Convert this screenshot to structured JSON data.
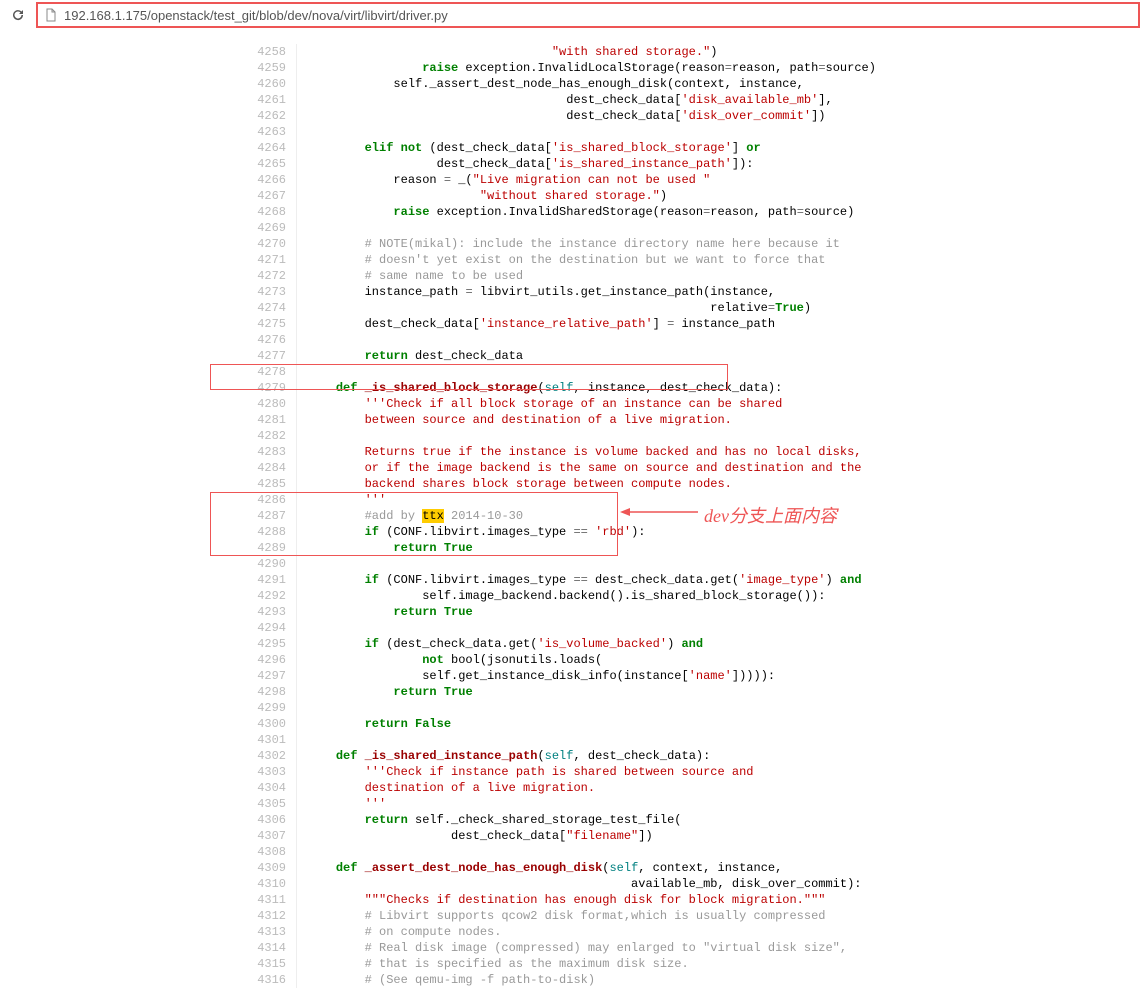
{
  "browser": {
    "url": "192.168.1.175/openstack/test_git/blob/dev/nova/virt/libvirt/driver.py"
  },
  "annotation": {
    "label": "dev分支上面内容"
  },
  "code": {
    "first_line": 4258,
    "lines": [
      {
        "i": 0,
        "w": [
          [
            "                                  ",
            ""
          ],
          [
            "\"with shared storage.\"",
            "stc"
          ],
          [
            ")",
            ""
          ]
        ]
      },
      {
        "i": 0,
        "w": [
          [
            "                ",
            ""
          ],
          [
            "raise",
            "kw"
          ],
          [
            " exception.InvalidLocalStorage(reason",
            ""
          ],
          [
            "=",
            "op"
          ],
          [
            "reason, path",
            ""
          ],
          [
            "=",
            "op"
          ],
          [
            "source)",
            ""
          ]
        ]
      },
      {
        "i": 0,
        "w": [
          [
            "            self._assert_dest_node_has_enough_disk(context, instance,",
            ""
          ]
        ]
      },
      {
        "i": 0,
        "w": [
          [
            "                                    dest_check_data[",
            ""
          ],
          [
            "'disk_available_mb'",
            "stc"
          ],
          [
            "],",
            ""
          ]
        ]
      },
      {
        "i": 0,
        "w": [
          [
            "                                    dest_check_data[",
            ""
          ],
          [
            "'disk_over_commit'",
            "stc"
          ],
          [
            "])",
            ""
          ]
        ]
      },
      {
        "i": 0,
        "w": [
          [
            "",
            ""
          ]
        ]
      },
      {
        "i": 0,
        "w": [
          [
            "        ",
            ""
          ],
          [
            "elif",
            "kw"
          ],
          [
            " ",
            ""
          ],
          [
            "not",
            "kw"
          ],
          [
            " (dest_check_data[",
            ""
          ],
          [
            "'is_shared_block_storage'",
            "stc"
          ],
          [
            "] ",
            ""
          ],
          [
            "or",
            "kw"
          ]
        ]
      },
      {
        "i": 0,
        "w": [
          [
            "                  dest_check_data[",
            ""
          ],
          [
            "'is_shared_instance_path'",
            "stc"
          ],
          [
            "]):",
            ""
          ]
        ]
      },
      {
        "i": 0,
        "w": [
          [
            "            reason ",
            ""
          ],
          [
            "=",
            "op"
          ],
          [
            " _(",
            ""
          ],
          [
            "\"Live migration can not be used \"",
            "stc"
          ]
        ]
      },
      {
        "i": 0,
        "w": [
          [
            "                        ",
            ""
          ],
          [
            "\"without shared storage.\"",
            "stc"
          ],
          [
            ")",
            ""
          ]
        ]
      },
      {
        "i": 0,
        "w": [
          [
            "            ",
            ""
          ],
          [
            "raise",
            "kw"
          ],
          [
            " exception.InvalidSharedStorage(reason",
            ""
          ],
          [
            "=",
            "op"
          ],
          [
            "reason, path",
            ""
          ],
          [
            "=",
            "op"
          ],
          [
            "source)",
            ""
          ]
        ]
      },
      {
        "i": 0,
        "w": [
          [
            "",
            ""
          ]
        ]
      },
      {
        "i": 0,
        "w": [
          [
            "        ",
            ""
          ],
          [
            "# NOTE(mikal): include the instance directory name here because it",
            "cmt"
          ]
        ]
      },
      {
        "i": 0,
        "w": [
          [
            "        ",
            ""
          ],
          [
            "# doesn't yet exist on the destination but we want to force that",
            "cmt"
          ]
        ]
      },
      {
        "i": 0,
        "w": [
          [
            "        ",
            ""
          ],
          [
            "# same name to be used",
            "cmt"
          ]
        ]
      },
      {
        "i": 0,
        "w": [
          [
            "        instance_path ",
            ""
          ],
          [
            "=",
            "op"
          ],
          [
            " libvirt_utils.get_instance_path(instance,",
            ""
          ]
        ]
      },
      {
        "i": 0,
        "w": [
          [
            "                                                        relative",
            ""
          ],
          [
            "=",
            "op"
          ],
          [
            "True",
            "bv"
          ],
          [
            ")",
            ""
          ]
        ]
      },
      {
        "i": 0,
        "w": [
          [
            "        dest_check_data[",
            ""
          ],
          [
            "'instance_relative_path'",
            "stc"
          ],
          [
            "] ",
            ""
          ],
          [
            "=",
            "op"
          ],
          [
            " instance_path",
            ""
          ]
        ]
      },
      {
        "i": 0,
        "w": [
          [
            "",
            ""
          ]
        ]
      },
      {
        "i": 0,
        "w": [
          [
            "        ",
            ""
          ],
          [
            "return",
            "kw"
          ],
          [
            " dest_check_data",
            ""
          ]
        ]
      },
      {
        "i": 0,
        "w": [
          [
            "",
            ""
          ]
        ]
      },
      {
        "i": 0,
        "w": [
          [
            "    ",
            ""
          ],
          [
            "def",
            "kw"
          ],
          [
            " ",
            ""
          ],
          [
            "_is_shared_block_storage",
            "fn"
          ],
          [
            "(",
            ""
          ],
          [
            "self",
            "arg"
          ],
          [
            ", instance, dest_check_data):",
            ""
          ]
        ]
      },
      {
        "i": 0,
        "w": [
          [
            "        ",
            ""
          ],
          [
            "'''Check if all block storage of an instance can be shared",
            "stc"
          ]
        ]
      },
      {
        "i": 0,
        "w": [
          [
            "        between source and destination of a live migration.",
            "stc"
          ]
        ]
      },
      {
        "i": 0,
        "w": [
          [
            "",
            "stc"
          ]
        ]
      },
      {
        "i": 0,
        "w": [
          [
            "        Returns true if the instance is volume backed and has no local disks,",
            "stc"
          ]
        ]
      },
      {
        "i": 0,
        "w": [
          [
            "        or if the image backend is the same on source and destination and the",
            "stc"
          ]
        ]
      },
      {
        "i": 0,
        "w": [
          [
            "        backend shares block storage between compute nodes.",
            "stc"
          ]
        ]
      },
      {
        "i": 0,
        "w": [
          [
            "        '''",
            "stc"
          ]
        ]
      },
      {
        "i": 0,
        "w": [
          [
            "        ",
            ""
          ],
          [
            "#add by ",
            "cmt"
          ],
          [
            "ttx",
            "hl"
          ],
          [
            " 2014-10-30",
            "cmt"
          ]
        ]
      },
      {
        "i": 0,
        "w": [
          [
            "        ",
            ""
          ],
          [
            "if",
            "kw"
          ],
          [
            " (CONF.libvirt.images_type ",
            ""
          ],
          [
            "==",
            "op"
          ],
          [
            " ",
            ""
          ],
          [
            "'rbd'",
            "stc"
          ],
          [
            "):",
            ""
          ]
        ]
      },
      {
        "i": 0,
        "w": [
          [
            "            ",
            ""
          ],
          [
            "return",
            "kw"
          ],
          [
            " ",
            ""
          ],
          [
            "True",
            "bv"
          ]
        ]
      },
      {
        "i": 0,
        "w": [
          [
            "",
            ""
          ]
        ]
      },
      {
        "i": 0,
        "w": [
          [
            "        ",
            ""
          ],
          [
            "if",
            "kw"
          ],
          [
            " (CONF.libvirt.images_type ",
            ""
          ],
          [
            "==",
            "op"
          ],
          [
            " dest_check_data.get(",
            ""
          ],
          [
            "'image_type'",
            "stc"
          ],
          [
            ") ",
            ""
          ],
          [
            "and",
            "kw"
          ]
        ]
      },
      {
        "i": 0,
        "w": [
          [
            "                self.image_backend.backend().is_shared_block_storage()):",
            ""
          ]
        ]
      },
      {
        "i": 0,
        "w": [
          [
            "            ",
            ""
          ],
          [
            "return",
            "kw"
          ],
          [
            " ",
            ""
          ],
          [
            "True",
            "bv"
          ]
        ]
      },
      {
        "i": 0,
        "w": [
          [
            "",
            ""
          ]
        ]
      },
      {
        "i": 0,
        "w": [
          [
            "        ",
            ""
          ],
          [
            "if",
            "kw"
          ],
          [
            " (dest_check_data.get(",
            ""
          ],
          [
            "'is_volume_backed'",
            "stc"
          ],
          [
            ") ",
            ""
          ],
          [
            "and",
            "kw"
          ]
        ]
      },
      {
        "i": 0,
        "w": [
          [
            "                ",
            ""
          ],
          [
            "not",
            "kw"
          ],
          [
            " bool(jsonutils.loads(",
            ""
          ]
        ]
      },
      {
        "i": 0,
        "w": [
          [
            "                self.get_instance_disk_info(instance[",
            ""
          ],
          [
            "'name'",
            "stc"
          ],
          [
            "])))):",
            ""
          ]
        ]
      },
      {
        "i": 0,
        "w": [
          [
            "            ",
            ""
          ],
          [
            "return",
            "kw"
          ],
          [
            " ",
            ""
          ],
          [
            "True",
            "bv"
          ]
        ]
      },
      {
        "i": 0,
        "w": [
          [
            "",
            ""
          ]
        ]
      },
      {
        "i": 0,
        "w": [
          [
            "        ",
            ""
          ],
          [
            "return",
            "kw"
          ],
          [
            " ",
            ""
          ],
          [
            "False",
            "bv"
          ]
        ]
      },
      {
        "i": 0,
        "w": [
          [
            "",
            ""
          ]
        ]
      },
      {
        "i": 0,
        "w": [
          [
            "    ",
            ""
          ],
          [
            "def",
            "kw"
          ],
          [
            " ",
            ""
          ],
          [
            "_is_shared_instance_path",
            "fn"
          ],
          [
            "(",
            ""
          ],
          [
            "self",
            "arg"
          ],
          [
            ", dest_check_data):",
            ""
          ]
        ]
      },
      {
        "i": 0,
        "w": [
          [
            "        ",
            ""
          ],
          [
            "'''Check if instance path is shared between source and",
            "stc"
          ]
        ]
      },
      {
        "i": 0,
        "w": [
          [
            "        destination of a live migration.",
            "stc"
          ]
        ]
      },
      {
        "i": 0,
        "w": [
          [
            "        '''",
            "stc"
          ]
        ]
      },
      {
        "i": 0,
        "w": [
          [
            "        ",
            ""
          ],
          [
            "return",
            "kw"
          ],
          [
            " self._check_shared_storage_test_file(",
            ""
          ]
        ]
      },
      {
        "i": 0,
        "w": [
          [
            "                    dest_check_data[",
            ""
          ],
          [
            "\"filename\"",
            "stc"
          ],
          [
            "])",
            ""
          ]
        ]
      },
      {
        "i": 0,
        "w": [
          [
            "",
            ""
          ]
        ]
      },
      {
        "i": 0,
        "w": [
          [
            "    ",
            ""
          ],
          [
            "def",
            "kw"
          ],
          [
            " ",
            ""
          ],
          [
            "_assert_dest_node_has_enough_disk",
            "fn"
          ],
          [
            "(",
            ""
          ],
          [
            "self",
            "arg"
          ],
          [
            ", context, instance,",
            ""
          ]
        ]
      },
      {
        "i": 0,
        "w": [
          [
            "                                             available_mb, disk_over_commit):",
            ""
          ]
        ]
      },
      {
        "i": 0,
        "w": [
          [
            "        ",
            ""
          ],
          [
            "\"\"\"Checks if destination has enough disk for block migration.\"\"\"",
            "stc"
          ]
        ]
      },
      {
        "i": 0,
        "w": [
          [
            "        ",
            ""
          ],
          [
            "# Libvirt supports qcow2 disk format,which is usually compressed",
            "cmt"
          ]
        ]
      },
      {
        "i": 0,
        "w": [
          [
            "        ",
            ""
          ],
          [
            "# on compute nodes.",
            "cmt"
          ]
        ]
      },
      {
        "i": 0,
        "w": [
          [
            "        ",
            ""
          ],
          [
            "# Real disk image (compressed) may enlarged to \"virtual disk size\",",
            "cmt"
          ]
        ]
      },
      {
        "i": 0,
        "w": [
          [
            "        ",
            ""
          ],
          [
            "# that is specified as the maximum disk size.",
            "cmt"
          ]
        ]
      },
      {
        "i": 0,
        "w": [
          [
            "        ",
            ""
          ],
          [
            "# (See qemu-img -f path-to-disk)",
            "cmt"
          ]
        ]
      }
    ]
  }
}
